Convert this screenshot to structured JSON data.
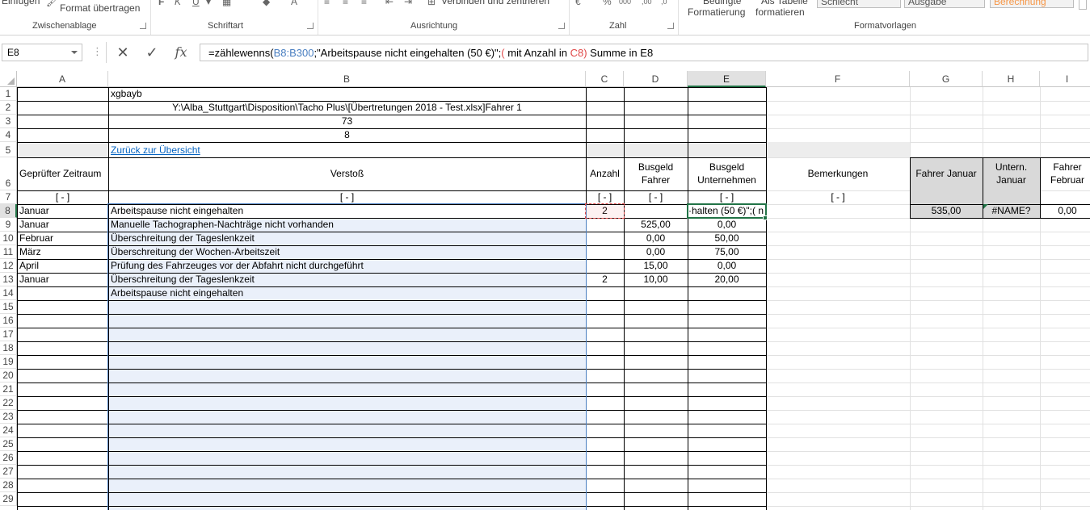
{
  "ribbon": {
    "top_items": [
      "Einfügen",
      "Format übertragen",
      "Verbinden und zentrieren",
      "Bedingte",
      "Als Tabelle",
      "Schlecht",
      "Ausgabe",
      "Berechnung"
    ],
    "conditional_formatting": "Formatierung",
    "format_as_table": "formatieren",
    "groups": [
      "Zwischenablage",
      "Schriftart",
      "Ausrichtung",
      "Zahl",
      "Formatvorlagen"
    ]
  },
  "formula_bar": {
    "name_box": "E8",
    "fx": "fx",
    "formula_prefix": "=zählewenns(",
    "formula_ref1": "B8:B300",
    "formula_mid": ";\"Arbeitspause nicht eingehalten (50 €)\";",
    "formula_paren": "(",
    "formula_text2": " mit Anzahl in ",
    "formula_ref2": "C8",
    "formula_paren2": ")",
    "formula_tail": " Summe in E8"
  },
  "columns": [
    "A",
    "B",
    "C",
    "D",
    "E",
    "F",
    "G",
    "H",
    "I"
  ],
  "rows": [
    "1",
    "2",
    "3",
    "4",
    "5",
    "6",
    "7",
    "8",
    "9",
    "10",
    "11",
    "12",
    "13",
    "14",
    "15",
    "16",
    "17",
    "18",
    "19",
    "20",
    "21",
    "22",
    "23",
    "24",
    "25",
    "26",
    "27",
    "28",
    "29"
  ],
  "sheet": {
    "b1": "xgbayb",
    "b2": "Y:\\Alba_Stuttgart\\Disposition\\Tacho Plus\\[Übertretungen 2018 - Test.xlsx]Fahrer 1",
    "b3": "73",
    "b4": "8",
    "b5_link": "Zurück zur Übersicht",
    "headers": {
      "a": "Geprüfter Zeitraum",
      "b": "Verstoß",
      "c": "Anzahl",
      "d": "Busgeld Fahrer",
      "e": "Busgeld Unternehmen",
      "f": "Bemerkungen",
      "g": "Fahrer Januar",
      "h": "Untern. Januar",
      "i": "Fahrer Februar"
    },
    "filter": "[ - ]",
    "edit_text": "·halten (50 €)\";( n",
    "g8": "535,00",
    "h8": "#NAME?",
    "i8": "0,00",
    "data_rows": [
      {
        "a": "Januar",
        "b": "Arbeitspause nicht eingehalten",
        "c": "2",
        "d": "",
        "e": ""
      },
      {
        "a": "Januar",
        "b": "Manuelle Tachographen-Nachträge nicht vorhanden",
        "c": "",
        "d": "525,00",
        "e": "0,00"
      },
      {
        "a": "Februar",
        "b": "Überschreitung der Tageslenkzeit",
        "c": "",
        "d": "0,00",
        "e": "50,00"
      },
      {
        "a": "März",
        "b": "Überschreitung der Wochen-Arbeitszeit",
        "c": "",
        "d": "0,00",
        "e": "75,00"
      },
      {
        "a": "April",
        "b": "Prüfung des Fahrzeuges vor der Abfahrt nicht durchgeführt",
        "c": "",
        "d": "15,00",
        "e": "0,00"
      },
      {
        "a": "Januar",
        "b": "Überschreitung der Tageslenkzeit",
        "c": "2",
        "d": "10,00",
        "e": "20,00"
      },
      {
        "a": "",
        "b": "Arbeitspause nicht eingehalten",
        "c": "",
        "d": "",
        "e": ""
      }
    ]
  }
}
